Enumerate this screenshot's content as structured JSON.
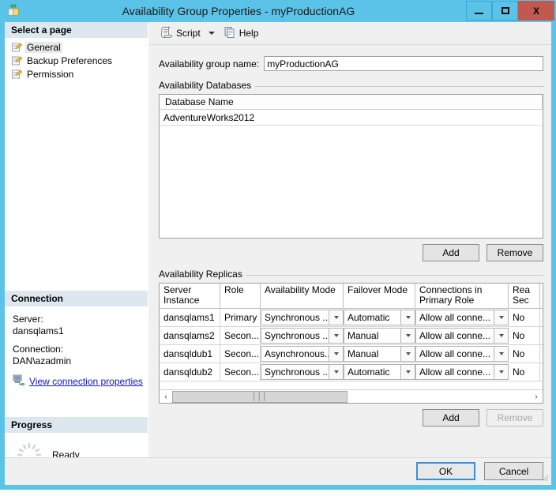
{
  "window": {
    "title": "Availability Group Properties - myProductionAG",
    "icon": "availability-group-icon",
    "controls": {
      "minimize": "minimize-icon",
      "maximize": "maximize-icon",
      "close": "X"
    }
  },
  "sidebar": {
    "select_page_header": "Select a page",
    "pages": [
      {
        "label": "General",
        "selected": true
      },
      {
        "label": "Backup Preferences",
        "selected": false
      },
      {
        "label": "Permission",
        "selected": false
      }
    ],
    "connection": {
      "header": "Connection",
      "server_label": "Server:",
      "server_value": "dansqlams1",
      "connection_label": "Connection:",
      "connection_value": "DAN\\azadmin",
      "link": "View connection properties"
    },
    "progress": {
      "header": "Progress",
      "status": "Ready"
    }
  },
  "toolbar": {
    "script_label": "Script",
    "help_label": "Help"
  },
  "main": {
    "ag_name_label": "Availability group name:",
    "ag_name_value": "myProductionAG",
    "databases": {
      "legend": "Availability Databases",
      "columns": [
        "Database Name"
      ],
      "rows": [
        "AdventureWorks2012"
      ],
      "add_label": "Add",
      "remove_label": "Remove",
      "add_disabled": false,
      "remove_disabled": false
    },
    "replicas": {
      "legend": "Availability Replicas",
      "columns": [
        "Server\nInstance",
        "Role",
        "Availability Mode",
        "Failover Mode",
        "Connections in\nPrimary Role",
        "Rea\nSec"
      ],
      "rows": [
        {
          "server_instance": "dansqlams1",
          "role": "Primary",
          "availability_mode": "Synchronous ...",
          "failover_mode": "Automatic",
          "connections_primary_role": "Allow all conne...",
          "readable_secondary": "No"
        },
        {
          "server_instance": "dansqlams2",
          "role": "Secon...",
          "availability_mode": "Synchronous ...",
          "failover_mode": "Manual",
          "connections_primary_role": "Allow all conne...",
          "readable_secondary": "No"
        },
        {
          "server_instance": "dansqldub1",
          "role": "Secon...",
          "availability_mode": "Asynchronous...",
          "failover_mode": "Manual",
          "connections_primary_role": "Allow all conne...",
          "readable_secondary": "No"
        },
        {
          "server_instance": "dansqldub2",
          "role": "Secon...",
          "availability_mode": "Synchronous ...",
          "failover_mode": "Automatic",
          "connections_primary_role": "Allow all conne...",
          "readable_secondary": "No"
        }
      ],
      "add_label": "Add",
      "remove_label": "Remove",
      "add_disabled": false,
      "remove_disabled": true,
      "scroll_left_icon": "chevron-left-icon",
      "scroll_right_icon": "chevron-right-icon"
    }
  },
  "footer": {
    "ok_label": "OK",
    "cancel_label": "Cancel"
  },
  "colors": {
    "titlebar": "#5cc3e8",
    "close_button": "#c05a4e",
    "group_header": "#dce7ef",
    "link": "#1414c8",
    "dialog_face": "#f0f0f0",
    "default_button_border": "#3b8fd4"
  }
}
